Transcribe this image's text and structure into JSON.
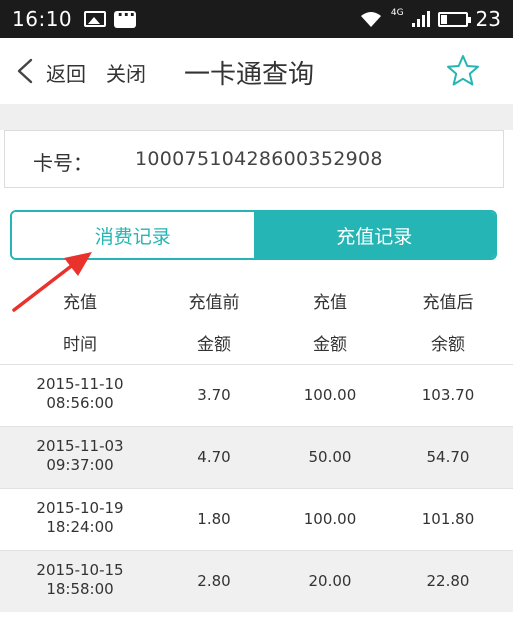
{
  "status_bar": {
    "time": "16:10",
    "network": "4G",
    "battery": "23"
  },
  "nav": {
    "back_label": "返回",
    "close_label": "关闭",
    "title": "一卡通查询"
  },
  "card": {
    "label": "卡号：",
    "number": "10007510428600352908"
  },
  "tabs": [
    {
      "label": "消费记录",
      "active": false
    },
    {
      "label": "充值记录",
      "active": true
    }
  ],
  "table": {
    "headers": [
      {
        "line1": "充值",
        "line2": "时间"
      },
      {
        "line1": "充值前",
        "line2": "金额"
      },
      {
        "line1": "充值",
        "line2": "金额"
      },
      {
        "line1": "充值后",
        "line2": "余额"
      }
    ],
    "rows": [
      {
        "date": "2015-11-10",
        "clock": "08:56:00",
        "before": "3.70",
        "amount": "100.00",
        "after": "103.70"
      },
      {
        "date": "2015-11-03",
        "clock": "09:37:00",
        "before": "4.70",
        "amount": "50.00",
        "after": "54.70"
      },
      {
        "date": "2015-10-19",
        "clock": "18:24:00",
        "before": "1.80",
        "amount": "100.00",
        "after": "101.80"
      },
      {
        "date": "2015-10-15",
        "clock": "18:58:00",
        "before": "2.80",
        "amount": "20.00",
        "after": "22.80"
      }
    ]
  },
  "colors": {
    "accent": "#25b5b4",
    "annotation": "#e8322b"
  }
}
